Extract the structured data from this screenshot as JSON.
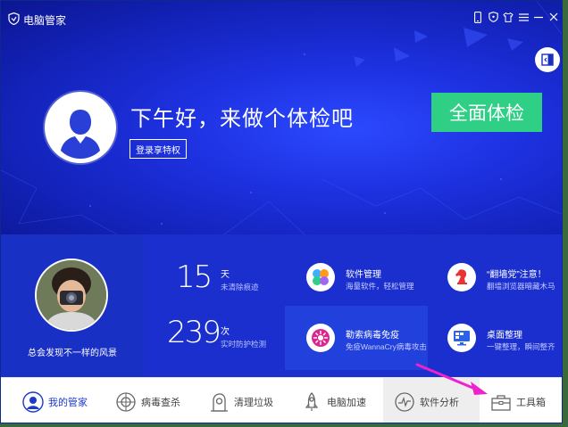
{
  "window": {
    "title": "电脑管家"
  },
  "titlebar_icons": [
    "phone-icon",
    "shield-icon",
    "shirt-icon",
    "menu-icon",
    "minimize-icon",
    "close-icon"
  ],
  "hero": {
    "greeting": "下午好，来做个体检吧",
    "login_label": "登录享特权",
    "scan_label": "全面体检"
  },
  "profile": {
    "caption": "总会发现不一样的风景"
  },
  "stats": [
    {
      "value": "15",
      "unit": "天",
      "desc": "未清除痕迹"
    },
    {
      "value": "239",
      "unit": "次",
      "desc": "实时防护检测"
    }
  ],
  "features": [
    {
      "title": "软件管理",
      "desc": "海量软件，轻松管理",
      "icon": "software-manager-icon"
    },
    {
      "title": "“翻墙党”注意！",
      "desc": "翻墙浏览器暗藏木马",
      "icon": "chess-knight-icon"
    },
    {
      "title": "勒索病毒免疫",
      "desc": "免疫WannaCry病毒攻击",
      "icon": "virus-immune-icon"
    },
    {
      "title": "桌面整理",
      "desc": "一键整理，瞬间整齐",
      "icon": "desktop-organize-icon"
    }
  ],
  "nav": [
    {
      "label": "我的管家",
      "icon": "my-assistant-icon"
    },
    {
      "label": "病毒查杀",
      "icon": "virus-scan-icon"
    },
    {
      "label": "清理垃圾",
      "icon": "cleanup-icon"
    },
    {
      "label": "电脑加速",
      "icon": "rocket-icon"
    },
    {
      "label": "软件分析",
      "icon": "software-analysis-icon"
    },
    {
      "label": "工具箱",
      "icon": "toolbox-icon"
    }
  ],
  "colors": {
    "hero_blue": "#1d31e0",
    "scan_green": "#2fcf85",
    "nav_active": "#1c3acb",
    "annotation_arrow": "#ee22cc"
  }
}
